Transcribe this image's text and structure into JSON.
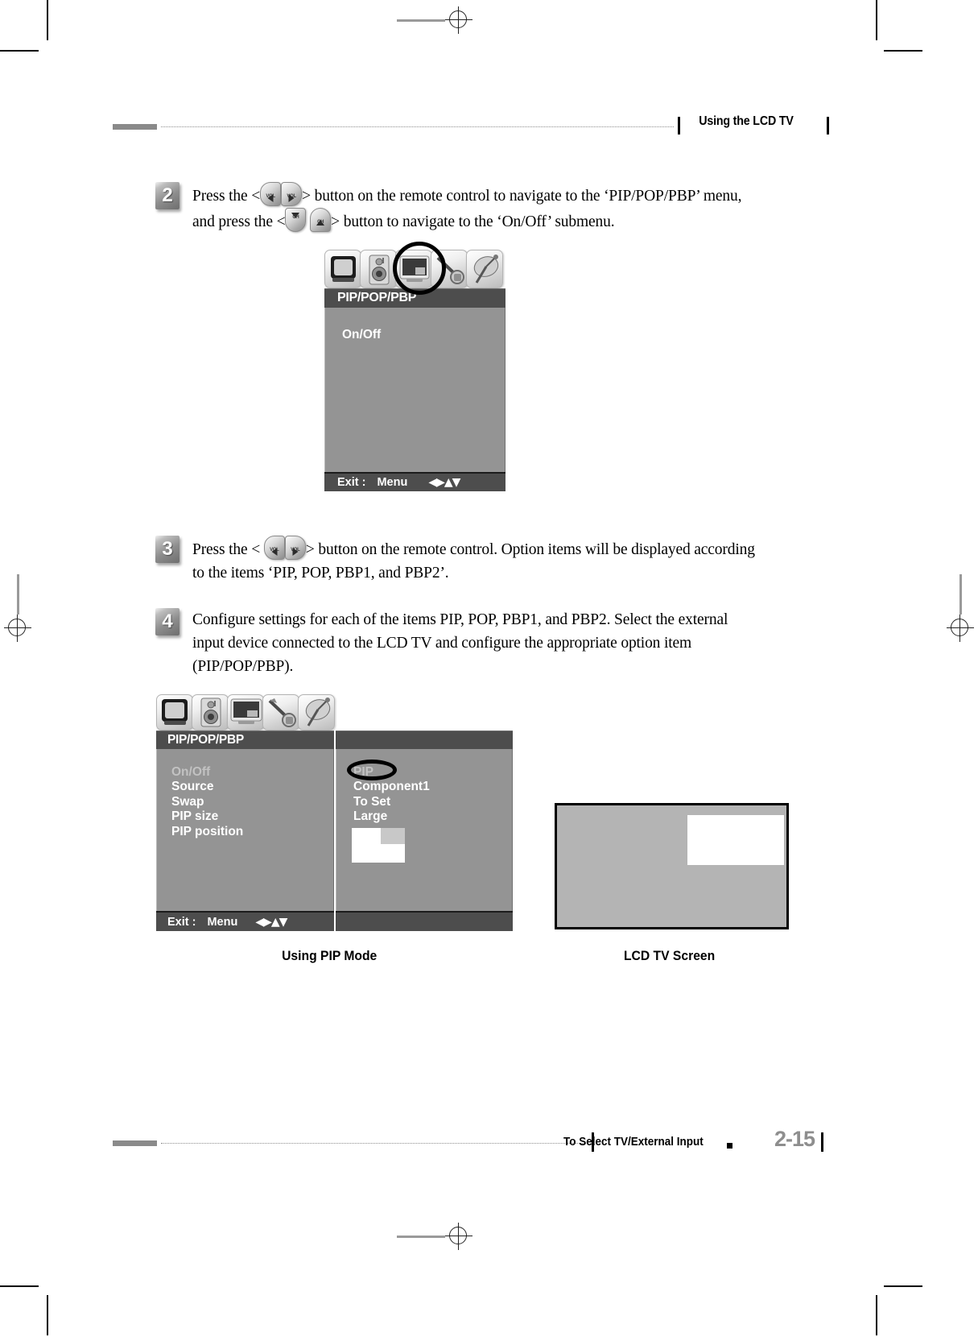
{
  "header": {
    "title": "Using the LCD TV"
  },
  "footer": {
    "section": "To Select TV/External Input",
    "page": "2-15"
  },
  "steps": [
    {
      "number": "2",
      "line1_a": "Press the <",
      "line1_b": "> button on the remote control to navigate to the ‘PIP/POP/PBP’ menu,",
      "line2_a": "and press the <",
      "line2_b": "> button to navigate to the ‘On/Off’ submenu.",
      "keys_line1": [
        "VOL-down",
        "VOL-up"
      ],
      "keys_line2": [
        "CH-down",
        "CH-up"
      ]
    },
    {
      "number": "3",
      "line1_a": "Press the <",
      "line1_b": "> button on the remote control. Option items will be displayed according",
      "line2": "to the items ‘PIP, POP, PBP1, and PBP2’.",
      "keys_line1": [
        "VOL-down",
        "VOL-up"
      ]
    },
    {
      "number": "4",
      "line1": "Configure settings for each of the items PIP, POP, PBP1, and PBP2.  Select the external",
      "line2": "input device connected to the LCD TV and configure the appropriate option item",
      "line3": "(PIP/POP/PBP)."
    }
  ],
  "osd_top": {
    "icons": [
      "tv-icon",
      "speaker-icon",
      "pip-monitor-icon",
      "tools-icon",
      "antenna-icon"
    ],
    "selected_icon_index": 2,
    "title": "PIP/POP/PBP",
    "menu_items": [
      "On/Off"
    ],
    "footer_exit": "Exit :",
    "footer_menu": "Menu",
    "footer_arrows": "◀▶▲▼"
  },
  "osd_bottom": {
    "icons": [
      "tv-icon",
      "speaker-icon",
      "pip-monitor-icon",
      "tools-icon",
      "antenna-icon"
    ],
    "selected_icon_index": 0,
    "title": "PIP/POP/PBP",
    "menu_items": [
      "On/Off",
      "Source",
      "Swap",
      "PIP size",
      "PIP position"
    ],
    "value_items": [
      "PIP",
      "Component1",
      "To Set",
      "Large"
    ],
    "highlighted_value": "PIP",
    "footer_exit": "Exit :",
    "footer_menu": "Menu",
    "footer_arrows": "◀▶▲▼"
  },
  "captions": {
    "left": "Using PIP Mode",
    "right": "LCD TV Screen"
  },
  "colors": {
    "osd_body": "#949494",
    "osd_bar": "#4d4d4d",
    "rule_gray": "#8a8a8a",
    "page_number": "#8e8e8e",
    "tv_screen": "#b4b4b4"
  }
}
